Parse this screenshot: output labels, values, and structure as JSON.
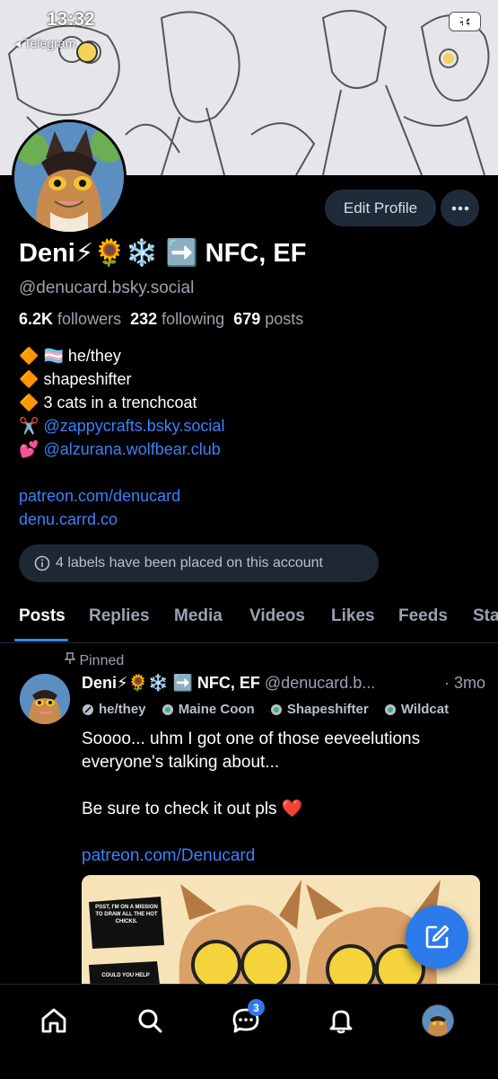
{
  "status_bar": {
    "time": "13:32",
    "back_app": "◂ Telegram",
    "battery": "94"
  },
  "profile": {
    "display_name": "Deni⚡🌻❄️ ➡️ NFC, EF",
    "handle": "@denucard.bsky.social",
    "followers_count": "6.2K",
    "followers_label": "followers",
    "following_count": "232",
    "following_label": "following",
    "posts_count": "679",
    "posts_label": "posts",
    "edit_button": "Edit Profile",
    "bio": [
      {
        "emoji": "🔶",
        "text": "🏳️‍⚧️ he/they"
      },
      {
        "emoji": "🔶",
        "text": "shapeshifter"
      },
      {
        "emoji": "🔶",
        "text": "3 cats in a trenchcoat"
      }
    ],
    "bio_links": [
      {
        "emoji": "✂️",
        "text": "@zappycrafts.bsky.social"
      },
      {
        "emoji": "💕",
        "text": "@alzurana.wolfbear.club"
      }
    ],
    "links": [
      "patreon.com/denucard",
      "denu.carrd.co"
    ],
    "labels_notice": "4 labels have been placed on this account"
  },
  "tabs": [
    "Posts",
    "Replies",
    "Media",
    "Videos",
    "Likes",
    "Feeds",
    "Sta"
  ],
  "post": {
    "pinned_label": "Pinned",
    "author_name": "Deni⚡🌻❄️ ➡️ NFC, EF",
    "author_handle": "@denucard.b...",
    "time": "· 3mo",
    "labels": [
      "he/they",
      "Maine Coon",
      "Shapeshifter",
      "Wildcat"
    ],
    "text_line1": "Soooo... uhm I got one of those eeveelutions",
    "text_line2": "everyone's talking about...",
    "text_line3": "Be sure to check it out pls ❤️",
    "link": "patreon.com/Denucard",
    "image_text_1": "PSST, I'M ON A MISSION TO DRAW ALL THE HOT CHICKS.",
    "image_text_2": "COULD YOU HELP"
  },
  "bottom_nav": {
    "chat_badge": "3"
  },
  "colors": {
    "accent": "#3b82f6",
    "background": "#000000",
    "pill": "#1f2b38"
  }
}
